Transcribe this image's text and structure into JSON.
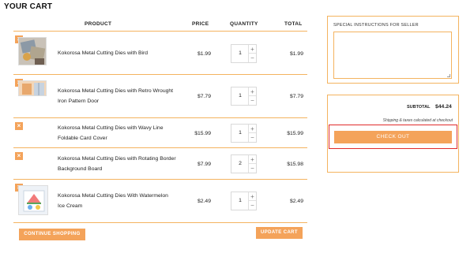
{
  "page": {
    "title": "YOUR CART"
  },
  "table": {
    "headers": {
      "product": "PRODUCT",
      "price": "PRICE",
      "quantity": "QUANTITY",
      "total": "TOTAL"
    },
    "rows": [
      {
        "remove": "×",
        "name": "Kokorosa Metal Cutting Dies with Bird",
        "price": "$1.99",
        "qty": "1",
        "total": "$1.99",
        "thumb": "bird-dies-image"
      },
      {
        "remove": "×",
        "name": "Kokorosa Metal Cutting Dies with Retro Wrought Iron Pattern Door",
        "price": "$7.79",
        "qty": "1",
        "total": "$7.79",
        "thumb": "door-dies-image"
      },
      {
        "remove": "×",
        "name": "Kokorosa Metal Cutting Dies with Wavy Line Foldable Card Cover",
        "price": "$15.99",
        "qty": "1",
        "total": "$15.99",
        "thumb": ""
      },
      {
        "remove": "×",
        "name": "Kokorosa Metal Cutting Dies with Rotating Border Background Board",
        "price": "$7.99",
        "qty": "2",
        "total": "$15.98",
        "thumb": ""
      },
      {
        "remove": "×",
        "name": "Kokorosa Metal Cutting Dies With Watermelon Ice Cream",
        "price": "$2.49",
        "qty": "1",
        "total": "$2.49",
        "thumb": "watermelon-dies-image"
      }
    ]
  },
  "buttons": {
    "continue": "CONTINUE SHOPPING",
    "update": "UPDATE CART",
    "checkout": "CHECK OUT",
    "plus": "+",
    "minus": "−"
  },
  "notes": {
    "label": "SPECIAL INSTRUCTIONS FOR SELLER",
    "value": ""
  },
  "summary": {
    "subtotal_label": "SUBTOTAL",
    "subtotal_value": "$44.24",
    "shipping_note": "Shipping & taxes calculated at checkout"
  },
  "colors": {
    "accent": "#f4a35a",
    "border": "#f4b35f",
    "highlight": "#e02b2b"
  }
}
